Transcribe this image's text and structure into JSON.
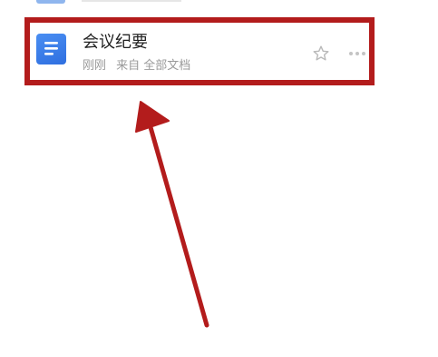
{
  "file_list": {
    "item": {
      "title": "会议纪要",
      "time": "刚刚",
      "source": "来自 全部文档",
      "doc_icon": "document-icon",
      "favorite_icon": "star-outline-icon",
      "more_icon": "more-horizontal-icon"
    }
  },
  "annotation": {
    "highlight_color": "#b31c1c",
    "arrow_color": "#b31c1c"
  },
  "colors": {
    "doc_icon": "#3a7ee9",
    "title_text": "#222222",
    "meta_text": "#9a9a9a"
  }
}
